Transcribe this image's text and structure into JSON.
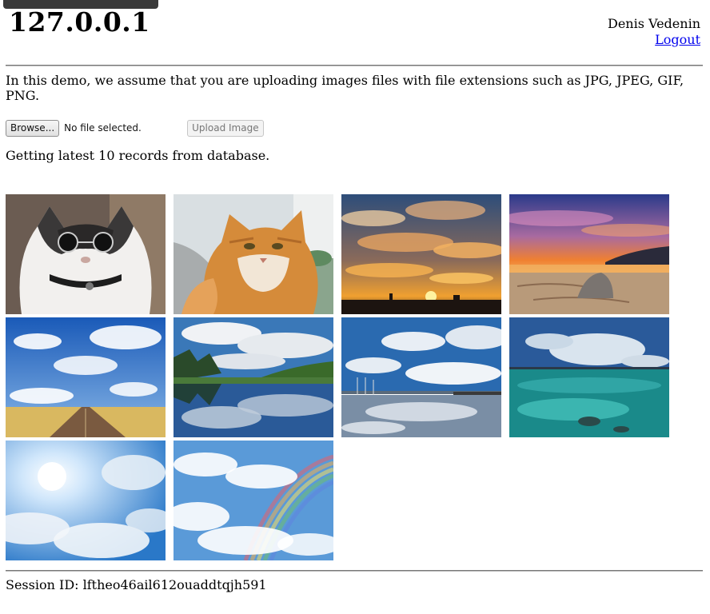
{
  "header": {
    "site_title": "127.0.0.1",
    "user_name": "Denis Vedenin",
    "logout_label": "Logout"
  },
  "intro_text": "In this demo, we assume that you are uploading images files with file extensions such as JPG, JPEG, GIF, PNG.",
  "upload": {
    "browse_label": "Browse...",
    "file_status": "No file selected.",
    "submit_label": "Upload Image"
  },
  "records_note": "Getting latest 10 records from database.",
  "gallery": {
    "images": [
      {
        "subject": "cat-with-sunglasses"
      },
      {
        "subject": "ginger-cat-selfie"
      },
      {
        "subject": "sunset-clouds-over-city"
      },
      {
        "subject": "sunset-beach-with-rock"
      },
      {
        "subject": "road-through-field-under-clouds"
      },
      {
        "subject": "lake-reflecting-clouds-and-trees"
      },
      {
        "subject": "pier-with-cloud-reflections"
      },
      {
        "subject": "turquoise-sea-with-clouds"
      },
      {
        "subject": "sun-rays-through-clouds"
      },
      {
        "subject": "rainbow-over-clouds"
      }
    ]
  },
  "session": {
    "label": "Session ID:",
    "id": "lftheo46ail612ouaddtqjh591"
  },
  "colors": {
    "link": "#0000ee",
    "rule": "#777777"
  }
}
